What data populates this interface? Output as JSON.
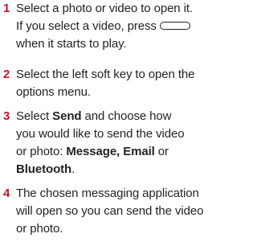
{
  "colors": {
    "step_number": "#c8102e",
    "text": "#231f20"
  },
  "steps": [
    {
      "number": "1",
      "line1": "Select a photo or video to open it.",
      "line2": "If you select a video, press",
      "icon": "end-key-icon",
      "line3": "when it starts to play."
    },
    {
      "number": "2",
      "line1": "Select the left soft key to open the",
      "line2": "options menu."
    },
    {
      "number": "3",
      "line1_a": "Select ",
      "line1_bold": "Send",
      "line1_b": " and choose how",
      "line2": "you would like to send the video",
      "line3_a": "or photo: ",
      "line3_bold": "Message, Email",
      "line3_b": " or",
      "line4_bold": "Bluetooth",
      "line4_b": "."
    },
    {
      "number": "4",
      "line1": "The chosen messaging application",
      "line2": "will open so you can send the video",
      "line3": "or photo."
    }
  ]
}
